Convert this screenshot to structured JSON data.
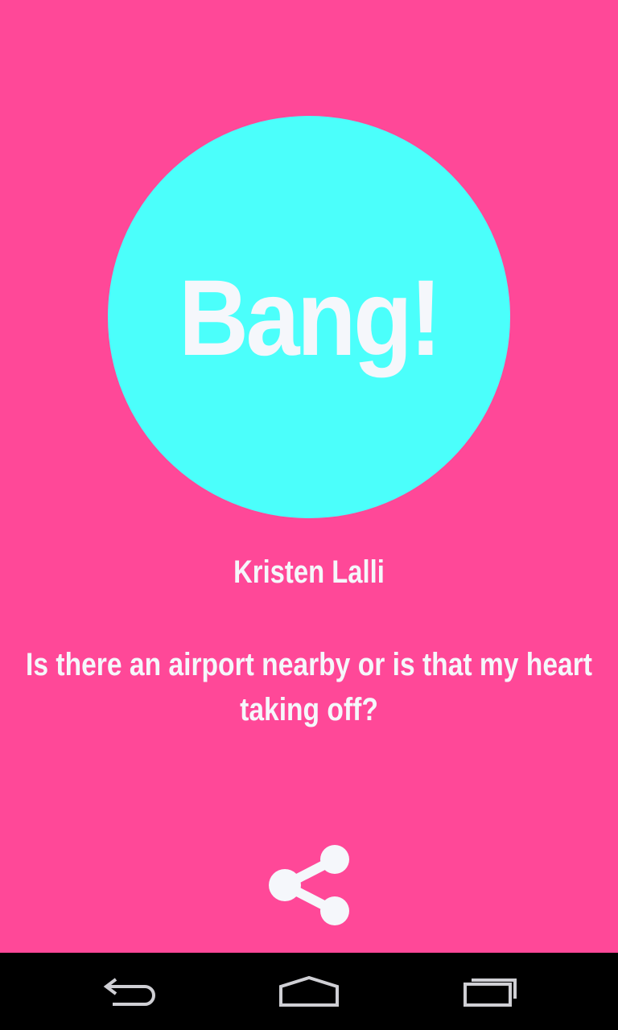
{
  "main": {
    "bang_button_label": "Bang!",
    "author_name": "Kristen Lalli",
    "quote_text": "Is there an airport nearby or is that my heart taking off?"
  },
  "icons": {
    "share": "share-icon",
    "back": "back-icon",
    "home": "home-icon",
    "recents": "recent-apps-icon"
  },
  "colors": {
    "background": "#ff4898",
    "circle": "#4bfffb",
    "text": "#f5f7fb",
    "navbar": "#000000",
    "nav_icons": "#cfcfd4"
  }
}
